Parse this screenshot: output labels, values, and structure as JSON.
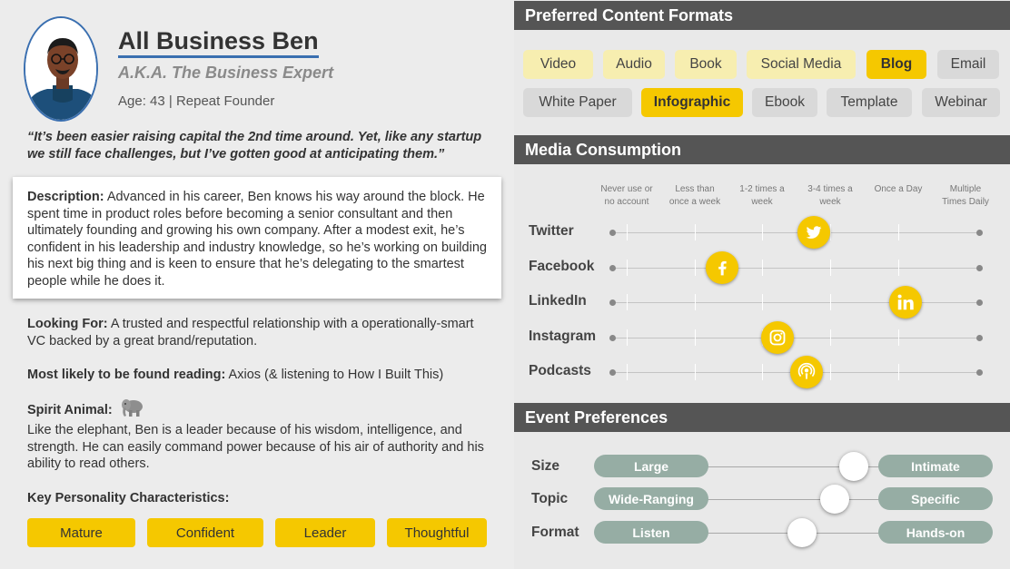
{
  "persona": {
    "name": "All Business Ben",
    "aka": "A.K.A. The Business Expert",
    "age_line": "Age: 43 | Repeat Founder",
    "quote": "“It’s been easier raising capital the 2nd time around. Yet, like any startup we still face challenges, but I’ve gotten good at anticipating them.”",
    "description_label": "Description:",
    "description": " Advanced in his career, Ben knows his way around the block. He spent time in product roles before becoming a senior consultant and then ultimately founding and growing his own company. After a modest exit, he’s confident in his leadership and industry knowledge, so he’s working on building his next big thing and is keen to ensure that he’s delegating to the smartest people while he does it.",
    "looking_for_label": "Looking For:",
    "looking_for": " A trusted and respectful relationship with a operationally-smart VC backed by a great brand/reputation.",
    "reading_label": "Most likely to be found reading:",
    "reading": "  Axios (& listening to How I Built This)",
    "spirit_label": "Spirit Animal:",
    "spirit_icon": "elephant-icon",
    "spirit_text": "Like the elephant, Ben is a leader because of his wisdom, intelligence, and strength. He can easily command power because of his air of authority and his ability to read others.",
    "traits_label": "Key Personality Characteristics:",
    "traits": [
      "Mature",
      "Confident",
      "Leader",
      "Thoughtful"
    ]
  },
  "formats": {
    "title": "Preferred Content Formats",
    "items": [
      {
        "label": "Video",
        "level": 1
      },
      {
        "label": "Audio",
        "level": 1
      },
      {
        "label": "Book",
        "level": 1
      },
      {
        "label": "Social Media",
        "level": 1
      },
      {
        "label": "Blog",
        "level": 2
      },
      {
        "label": "Email",
        "level": 0
      },
      {
        "label": "White Paper",
        "level": 0
      },
      {
        "label": "Infographic",
        "level": 2
      },
      {
        "label": "Ebook",
        "level": 0
      },
      {
        "label": "Template",
        "level": 0
      },
      {
        "label": "Webinar",
        "level": 0
      }
    ]
  },
  "media": {
    "title": "Media Consumption",
    "columns": [
      "Never use or\nno account",
      "Less than\nonce a week",
      "1-2 times a\nweek",
      "3-4 times a\nweek",
      "Once a Day",
      "Multiple\nTimes Daily"
    ],
    "rows": [
      {
        "name": "Twitter",
        "icon": "twitter-icon",
        "value": 0.55
      },
      {
        "name": "Facebook",
        "icon": "facebook-icon",
        "value": 0.3
      },
      {
        "name": "LinkedIn",
        "icon": "linkedin-icon",
        "value": 0.8
      },
      {
        "name": "Instagram",
        "icon": "instagram-icon",
        "value": 0.45
      },
      {
        "name": "Podcasts",
        "icon": "podcast-icon",
        "value": 0.53
      }
    ]
  },
  "events": {
    "title": "Event Preferences",
    "rows": [
      {
        "name": "Size",
        "left": "Large",
        "right": "Intimate",
        "value": 0.85
      },
      {
        "name": "Topic",
        "left": "Wide-Ranging",
        "right": "Specific",
        "value": 0.74
      },
      {
        "name": "Format",
        "left": "Listen",
        "right": "Hands-on",
        "value": 0.55
      }
    ]
  },
  "colors": {
    "accent_yellow": "#f5c800",
    "light_yellow": "#f7eeb0",
    "header_gray": "#555555",
    "pill_green": "#96ada4",
    "name_underline": "#3a6fb0"
  }
}
